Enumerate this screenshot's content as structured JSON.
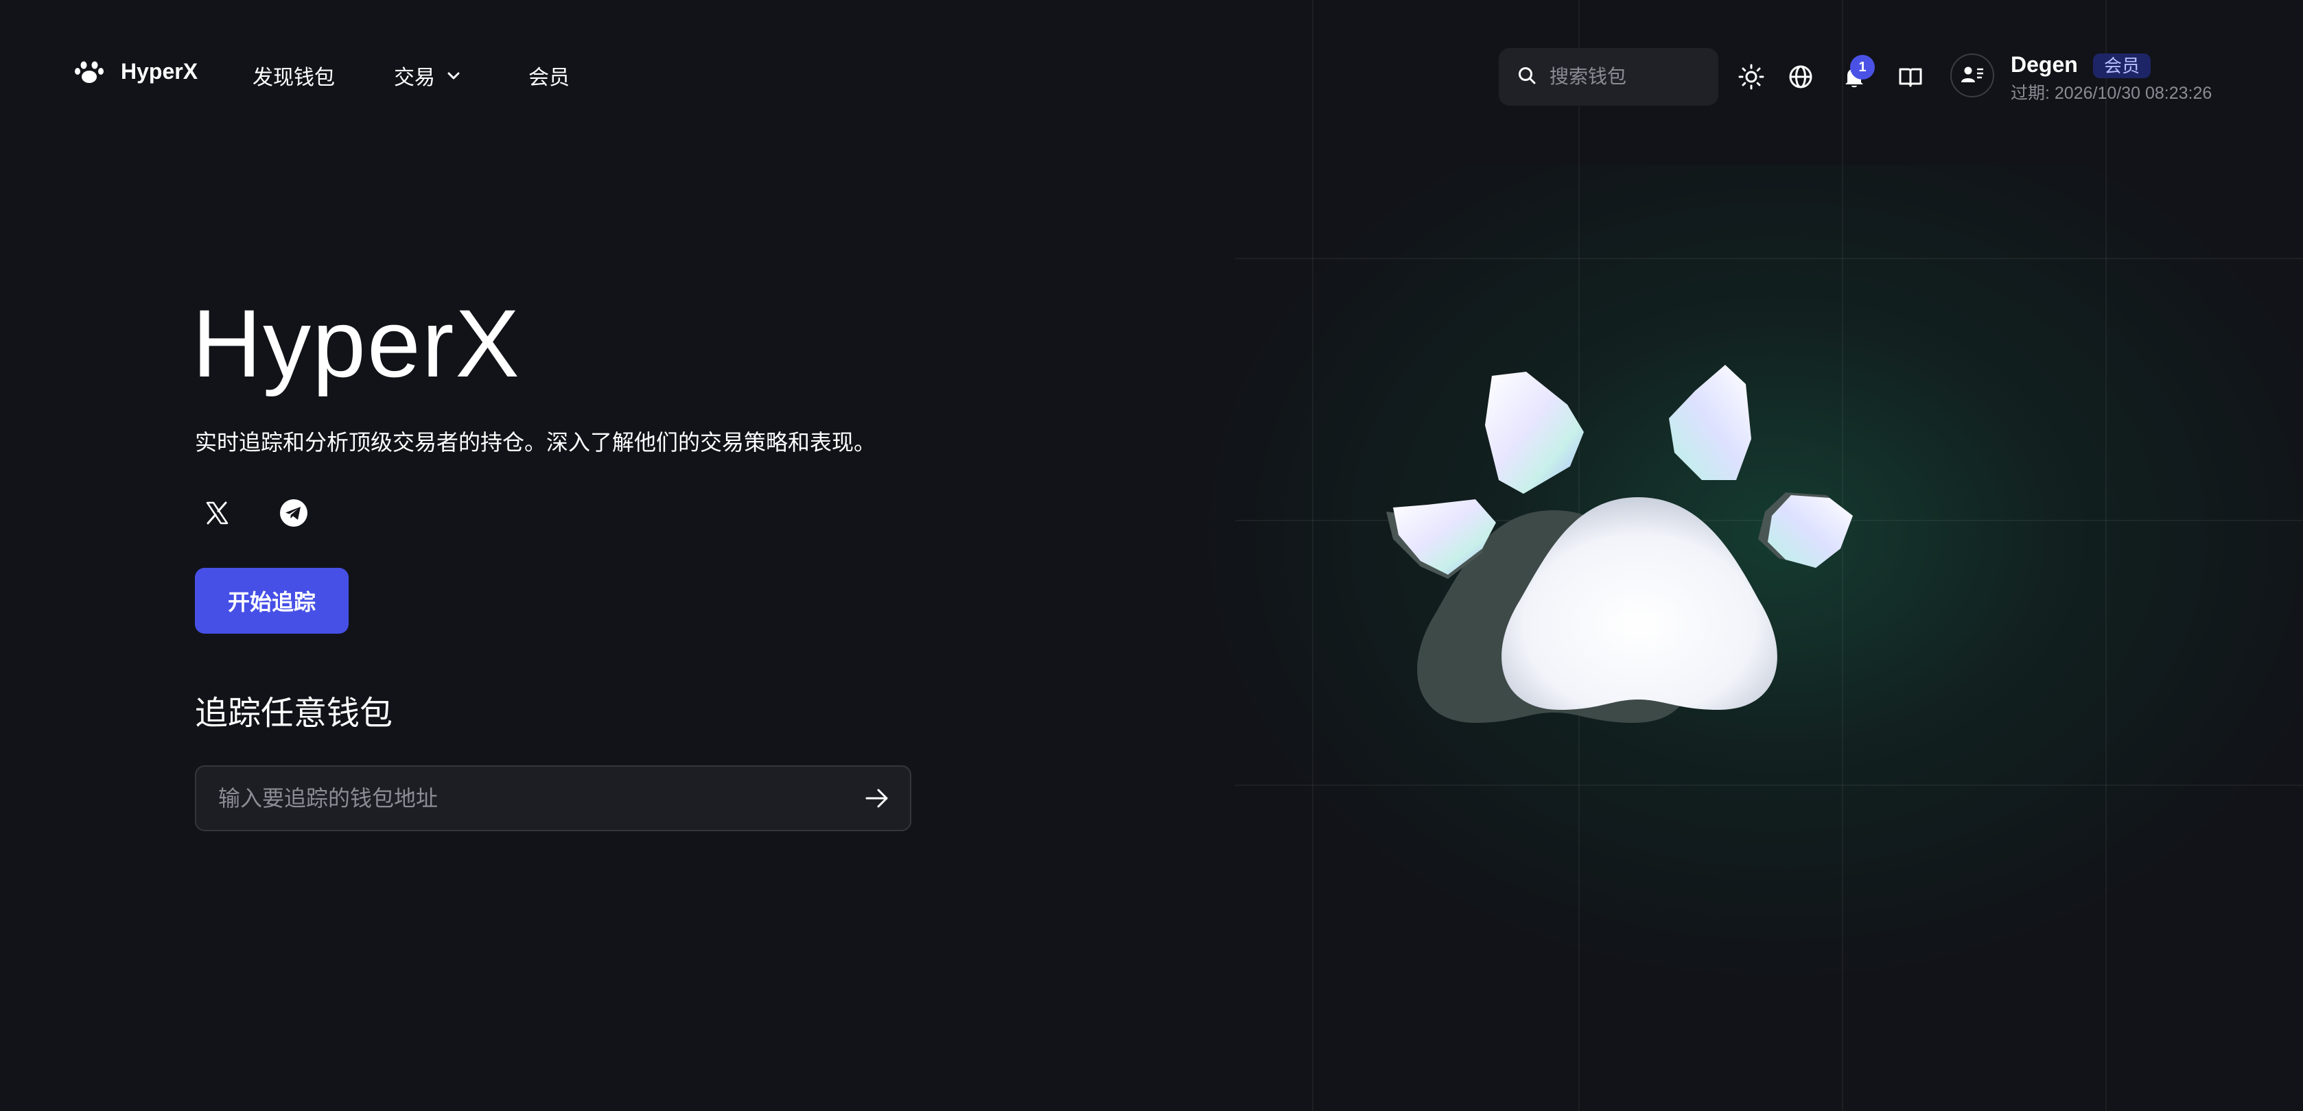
{
  "header": {
    "brand_name": "HyperX",
    "nav": {
      "discover_label": "发现钱包",
      "trade_label": "交易",
      "membership_label": "会员"
    },
    "search": {
      "placeholder": "搜索钱包",
      "value": ""
    },
    "notification_count": "1",
    "user": {
      "name": "Degen",
      "badge": "会员",
      "expiry": "过期: 2026/10/30 08:23:26"
    },
    "icons": [
      "paw-logo-icon",
      "chevron-down-icon",
      "search-icon",
      "sun-icon",
      "globe-icon",
      "bell-icon",
      "book-icon",
      "user-card-icon"
    ]
  },
  "hero": {
    "title": "HyperX",
    "description": "实时追踪和分析顶级交易者的持仓。深入了解他们的交易策略和表现。",
    "socials": [
      "x-icon",
      "telegram-icon"
    ],
    "cta_label": "开始追踪"
  },
  "tracker": {
    "title": "追踪任意钱包",
    "input_placeholder": "输入要追踪的钱包地址",
    "input_value": ""
  },
  "colors": {
    "background": "#111318",
    "accent": "#4650e6",
    "glow": "#185c44",
    "badge_bg": "#1e2566",
    "badge_text": "#b8c0ff"
  }
}
